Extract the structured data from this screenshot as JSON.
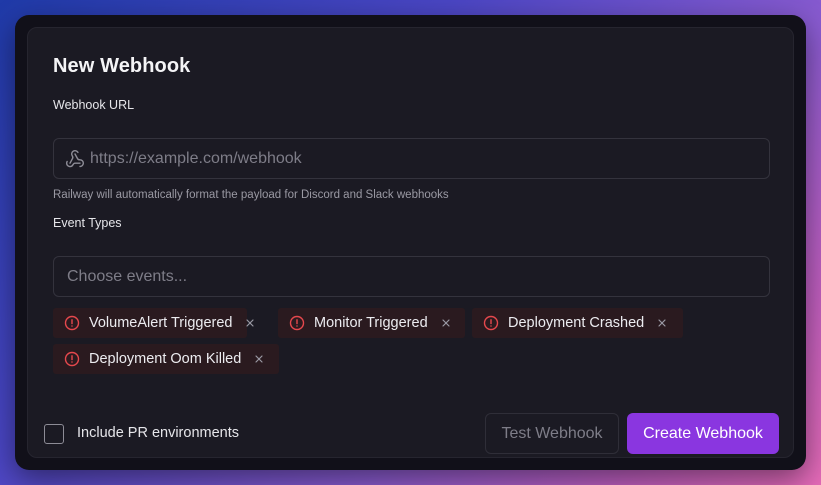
{
  "dialog": {
    "title": "New Webhook"
  },
  "webhook_url": {
    "label": "Webhook URL",
    "placeholder": "https://example.com/webhook",
    "value": "",
    "icon": "webhook-icon",
    "hint": "Railway will automatically format the payload for Discord and Slack webhooks"
  },
  "event_types": {
    "label": "Event Types",
    "placeholder": "Choose events...",
    "selected": [
      {
        "label": "VolumeAlert Triggered",
        "icon": "alert-circle-icon"
      },
      {
        "label": "Monitor Triggered",
        "icon": "alert-circle-icon"
      },
      {
        "label": "Deployment Crashed",
        "icon": "alert-circle-icon"
      },
      {
        "label": "Deployment Oom Killed",
        "icon": "alert-circle-icon"
      }
    ]
  },
  "footer": {
    "include_pr_label": "Include PR environments",
    "include_pr_checked": false,
    "test_button": "Test Webhook",
    "create_button": "Create Webhook"
  },
  "colors": {
    "accent": "#8a36e0",
    "chip_background": "#2a1a1f",
    "alert_icon": "#e5484d"
  }
}
